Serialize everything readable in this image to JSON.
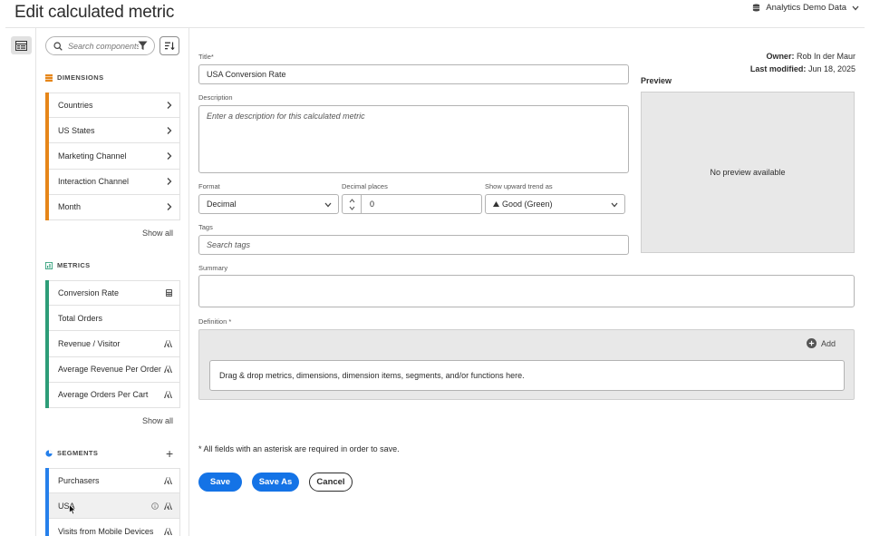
{
  "header": {
    "title": "Edit calculated metric",
    "report_suite": "Analytics Demo Data"
  },
  "panel": {
    "search_placeholder": "Search components",
    "dimensions": {
      "label": "DIMENSIONS",
      "items": [
        "Countries",
        "US States",
        "Marketing Channel",
        "Interaction Channel",
        "Month"
      ],
      "show_all": "Show all"
    },
    "metrics": {
      "label": "METRICS",
      "items": [
        "Conversion Rate",
        "Total Orders",
        "Revenue / Visitor",
        "Average Revenue Per Order",
        "Average Orders Per Cart"
      ],
      "show_all": "Show all"
    },
    "segments": {
      "label": "SEGMENTS",
      "items": [
        "Purchasers",
        "USA",
        "Visits from Mobile Devices"
      ]
    }
  },
  "form": {
    "owner_label": "Owner:",
    "owner_value": "Rob In der Maur",
    "modified_label": "Last modified:",
    "modified_value": "Jun 18, 2025",
    "title_label": "Title",
    "title_value": "USA Conversion Rate",
    "description_label": "Description",
    "description_placeholder": "Enter a description for this calculated metric",
    "format_label": "Format",
    "format_value": "Decimal",
    "decimal_label": "Decimal places",
    "decimal_value": "0",
    "trend_label": "Show upward trend as",
    "trend_value": "Good (Green)",
    "tags_label": "Tags",
    "tags_placeholder": "Search tags",
    "summary_label": "Summary",
    "definition_label": "Definition",
    "definition_add": "Add",
    "definition_drop": "Drag & drop metrics, dimensions, dimension items, segments, and/or functions here.",
    "preview_title": "Preview",
    "preview_empty": "No preview available",
    "required_note": "All fields with an asterisk are required in order to save.",
    "save": "Save",
    "save_as": "Save As",
    "cancel": "Cancel"
  },
  "colors": {
    "dimension": "#e68619",
    "metric": "#2d9d78",
    "segment": "#2680eb",
    "primary": "#1473e6"
  }
}
